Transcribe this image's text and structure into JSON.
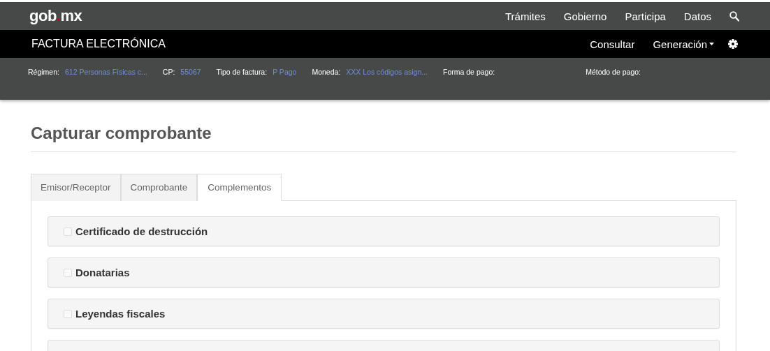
{
  "top_nav": {
    "logo": {
      "left": "gob",
      "dot": ".",
      "right": "mx"
    },
    "links": [
      "Trámites",
      "Gobierno",
      "Participa",
      "Datos"
    ]
  },
  "app_bar": {
    "title": "FACTURA ELECTRÓNICA",
    "links": [
      {
        "label": "Consultar",
        "kind": "link"
      },
      {
        "label": "Generación",
        "kind": "dropdown"
      }
    ]
  },
  "info_bar": [
    {
      "label": "Régimen:",
      "value": "612 Personas Físicas c..."
    },
    {
      "label": "CP:",
      "value": "55067"
    },
    {
      "label": "Tipo de factura:",
      "value": "P Pago"
    },
    {
      "label": "Moneda:",
      "value": "XXX Los códigos asign..."
    },
    {
      "label": "Forma de pago:"
    },
    {
      "label": "Método de pago:"
    }
  ],
  "page_title": "Capturar comprobante",
  "tabs": [
    {
      "label": "Emisor/Receptor",
      "selected": false
    },
    {
      "label": "Comprobante",
      "selected": false
    },
    {
      "label": "Complementos",
      "selected": true
    }
  ],
  "complements": [
    {
      "label": "Certificado de destrucción",
      "checked": false
    },
    {
      "label": "Donatarias",
      "checked": false
    },
    {
      "label": "Leyendas fiscales",
      "checked": false
    }
  ]
}
